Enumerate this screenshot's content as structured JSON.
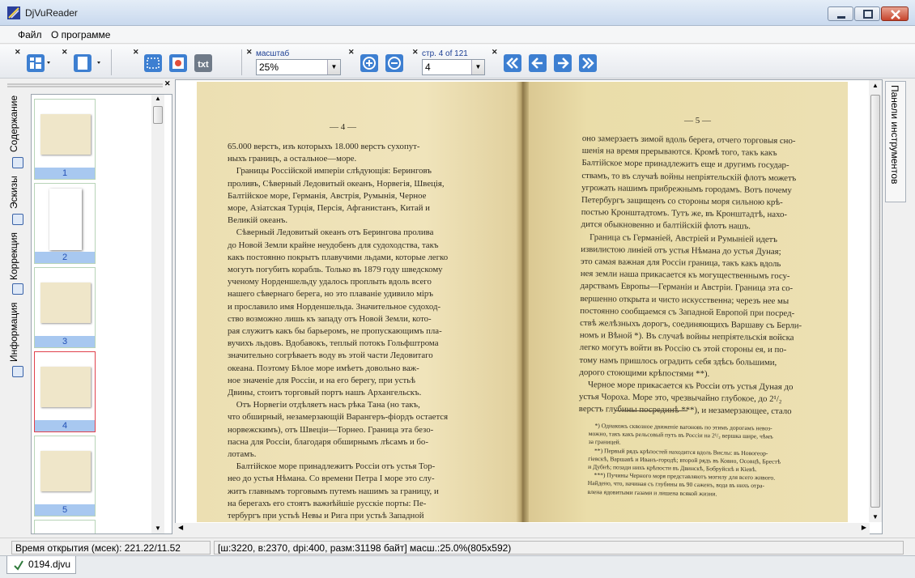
{
  "window": {
    "title": "DjVuReader",
    "icon": "djvu-app-icon"
  },
  "menu": {
    "items": [
      "Файл",
      "О программе"
    ]
  },
  "toolbar": {
    "zoom_label": "масштаб",
    "zoom_value": "25%",
    "page_label": "стр. 4 of 121",
    "page_value": "4",
    "txt_label": "txt",
    "buttons": [
      "layout-icon",
      "page-view-icon",
      "select-rect-icon",
      "image-icon",
      "txt-icon",
      "zoom-in-icon",
      "zoom-out-icon",
      "first-page-icon",
      "prev-page-icon",
      "next-page-icon",
      "last-page-icon"
    ]
  },
  "sidebar": {
    "tabs": [
      "Содержание",
      "Эскизы",
      "Коррекция",
      "Информация"
    ],
    "thumbnails": [
      "1",
      "2",
      "3",
      "4",
      "5"
    ],
    "active_thumbnail": "4"
  },
  "right_panel": {
    "label": "Панели инструментов"
  },
  "document": {
    "left_page_number": "— 4 —",
    "right_page_number": "— 5 —",
    "left_text": "65.000 верстъ, изъ которыхъ 18.000 верстъ сухопут-\nныхъ границъ, а остальное—море.\n    Границы Россійской имперіи слѣдующія: Беринговъ\nпроливъ, Сѣверный Ледовитый океанъ, Норвегія, Швеція,\nБалтійское море, Германія, Австрія, Румынія, Черное\nморе, Азіатская Турція, Персія, Афганистанъ, Китай и\nВеликій океанъ.\n    Сѣверный Ледовитый океанъ отъ Берингова пролива\nдо Новой Земли крайне неудобенъ для судоходства, такъ\nкакъ постоянно покрытъ плавучими льдами, которые легко\nмогутъ погубить корабль. Только въ 1879 году шведскому\nученому Норденшельду удалось проплыть вдоль всего\nнашего сѣвернаго берега, но это плаваніе удивило міръ\nи прославило имя Норденшельда. Значительное судоход-\nство возможно лишь къ западу отъ Новой Земли, кото-\nрая служитъ какъ бы барьеромъ, не пропускающимъ пла-\nвучихъ льдовъ. Вдобавокъ, теплый потокъ Гольфштрома\nзначительно согрѣваетъ воду въ этой части Ледовитаго\nокеана. Поэтому Бѣлое море имѣетъ довольно важ-\nное значеніе для Россіи, и на его берегу, при устьѣ\nДвины, стоитъ торговый портъ нашъ Архангельскъ.\n    Отъ Норвегіи отдѣляетъ насъ рѣка Тана (но такъ,\nчто обширный, незамерзающій Варангеръ-фіордъ остается\nнорвежскимъ), отъ Швеціи—Торнео. Граница эта безо-\nпасна для Россіи, благодаря обширнымъ лѣсамъ и бо-\nлотамъ.\n    Балтійское море принадлежитъ Россіи отъ устья Тор-\nнео до устья Нѣмана. Со времени Петра I море это слу-\nжитъ главнымъ торговымъ путемъ нашимъ за границу, и\nна берегахъ его стоятъ важнѣйшіе русскіе порты: Пе-\nтербургъ при устьѣ Невы и Рига при устьѣ Западной\nДвины. Неудобство этого моря заключается въ томъ, что",
    "right_text": "оно замерзаетъ зимой вдоль берега, отчего торговыя сно-\nшенія на время прерываются. Кромѣ того, такъ какъ\nБалтійское море принадлежитъ еще и другимъ государ-\nствамъ, то въ случаѣ войны непріятельскій флотъ можетъ\nугрожать нашимъ прибрежнымъ городамъ. Вотъ почему\nПетербургъ защищенъ со стороны моря сильною крѣ-\nпостью Кронштадтомъ. Тутъ же, въ Кронштадтѣ, нахо-\nдится обыкновенно и балтійскій флотъ нашъ.\n    Граница съ Германіей, Австріей и Румыніей идетъ\nизвилистою линіей отъ устья Нѣмана до устья Дуная;\nэто самая важная для Россіи граница, такъ какъ вдоль\nнея земли наша прикасается къ могущественнымъ госу-\nдарствамъ Европы—Германіи и Австріи. Граница эта со-\nвершенно открыта и чисто искусственна; черезъ нее мы\nпостоянно сообщаемся съ Западной Европой при посред-\nствѣ желѣзныхъ дорогъ, соединяющихъ Варшаву съ Берли-\nномъ и Вѣной *). Въ случаѣ войны непріятельскія войска\nлегко могутъ войти въ Россію съ этой стороны ея, и по-\nтому намъ пришлось оградить себя здѣсь большими,\nдорого стоющими крѣпостями **).\n    Черное море прикасается къ Россіи отъ устья Дуная до\nустья Чороха. Море это, чрезвычайно глубокое, до 2¹/₂\nверстъ глубины посрединѣ ***), и незамерзающее, стало",
    "footnotes": "    *) Однакожъ сквозное движеніе вагоновъ по этимъ дорогамъ невоз-\nможно, такъ какъ рельсовый путь въ Россіи на 2¹/₂ вершка шире, чѣмъ\nза границей.\n    **) Первый рядъ крѣпостей находится вдоль Вислы: въ Новогеор-\nгіевскѣ, Варшавѣ и Иванъ-городѣ; второй рядъ въ Ковно, Осовцѣ, Брестѣ\nи Дубнѣ; позади нихъ крѣпости въ Двинскѣ, Бобруйскѣ и Кіевѣ.\n    ***) Пучины Черного моря представляютъ могилу для всего живого.\nНайдено, что, начиная съ глубины въ 90 саженъ, вода въ нихъ отра-\nвлена ядовитыми газами и лишена всякой жизни."
  },
  "status": {
    "open_time": "Время открытия (мсек): 221.22/11.52",
    "info": "[ш:3220, в:2370, dpi:400, разм:31198 байт] масш.:25.0%(805x592)"
  },
  "tabs": {
    "file": "0194.djvu"
  }
}
